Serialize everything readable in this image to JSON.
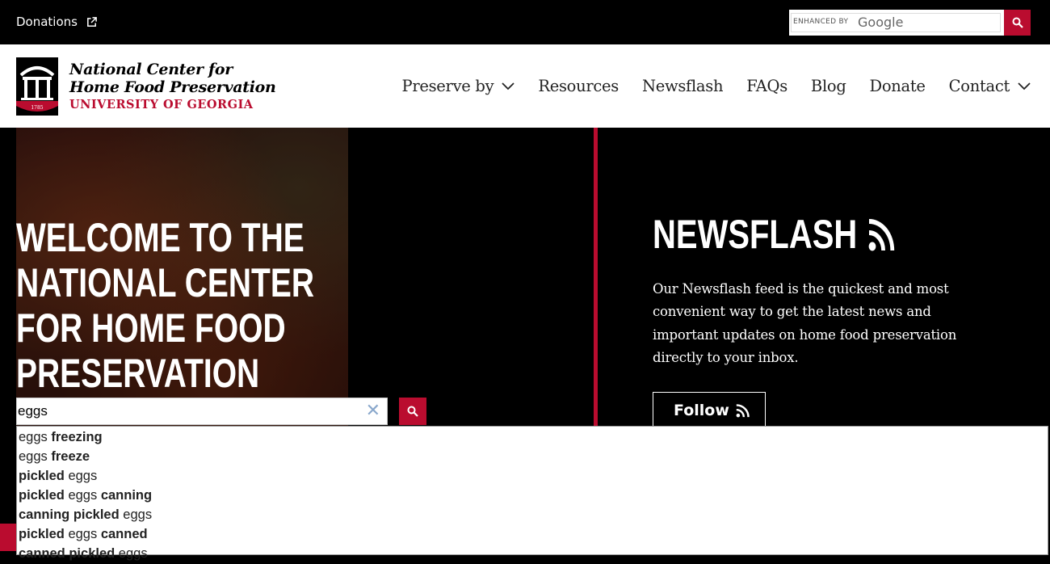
{
  "topbar": {
    "donations_label": "Donations",
    "search": {
      "enhanced_by": "ENHANCED BY",
      "provider": "Google"
    }
  },
  "header": {
    "brand": {
      "line1": "National Center for",
      "line2": "Home Food Preservation",
      "line3": "UNIVERSITY OF GEORGIA",
      "seal_year": "1785"
    },
    "nav": [
      {
        "label": "Preserve by",
        "has_dropdown": true
      },
      {
        "label": "Resources",
        "has_dropdown": false
      },
      {
        "label": "Newsflash",
        "has_dropdown": false
      },
      {
        "label": "FAQs",
        "has_dropdown": false
      },
      {
        "label": "Blog",
        "has_dropdown": false
      },
      {
        "label": "Donate",
        "has_dropdown": false
      },
      {
        "label": "Contact",
        "has_dropdown": true
      }
    ]
  },
  "hero": {
    "title": "WELCOME TO THE NATIONAL CENTER FOR HOME FOOD PRESERVATION",
    "search": {
      "value": "eggs",
      "clear_glyph": "✕"
    }
  },
  "newsflash": {
    "title": "NEWSFLASH",
    "text": "Our Newsflash feed is the quickest and most convenient way to get the latest news and important updates on home food preservation directly to your inbox.",
    "follow_label": "Follow"
  },
  "suggestions": [
    [
      {
        "t": "eggs",
        "b": false
      },
      {
        "t": " freezing",
        "b": true
      }
    ],
    [
      {
        "t": "eggs",
        "b": false
      },
      {
        "t": " freeze",
        "b": true
      }
    ],
    [
      {
        "t": "pickled",
        "b": true
      },
      {
        "t": " eggs",
        "b": false
      }
    ],
    [
      {
        "t": "pickled",
        "b": true
      },
      {
        "t": " eggs",
        "b": false
      },
      {
        "t": " canning",
        "b": true
      }
    ],
    [
      {
        "t": "canning pickled",
        "b": true
      },
      {
        "t": " eggs",
        "b": false
      }
    ],
    [
      {
        "t": "pickled",
        "b": true
      },
      {
        "t": " eggs",
        "b": false
      },
      {
        "t": " canned",
        "b": true
      }
    ],
    [
      {
        "t": "canned pickled",
        "b": true
      },
      {
        "t": " eggs",
        "b": false
      }
    ]
  ],
  "colors": {
    "accent": "#ba0c2f",
    "black": "#000000",
    "white": "#ffffff"
  }
}
